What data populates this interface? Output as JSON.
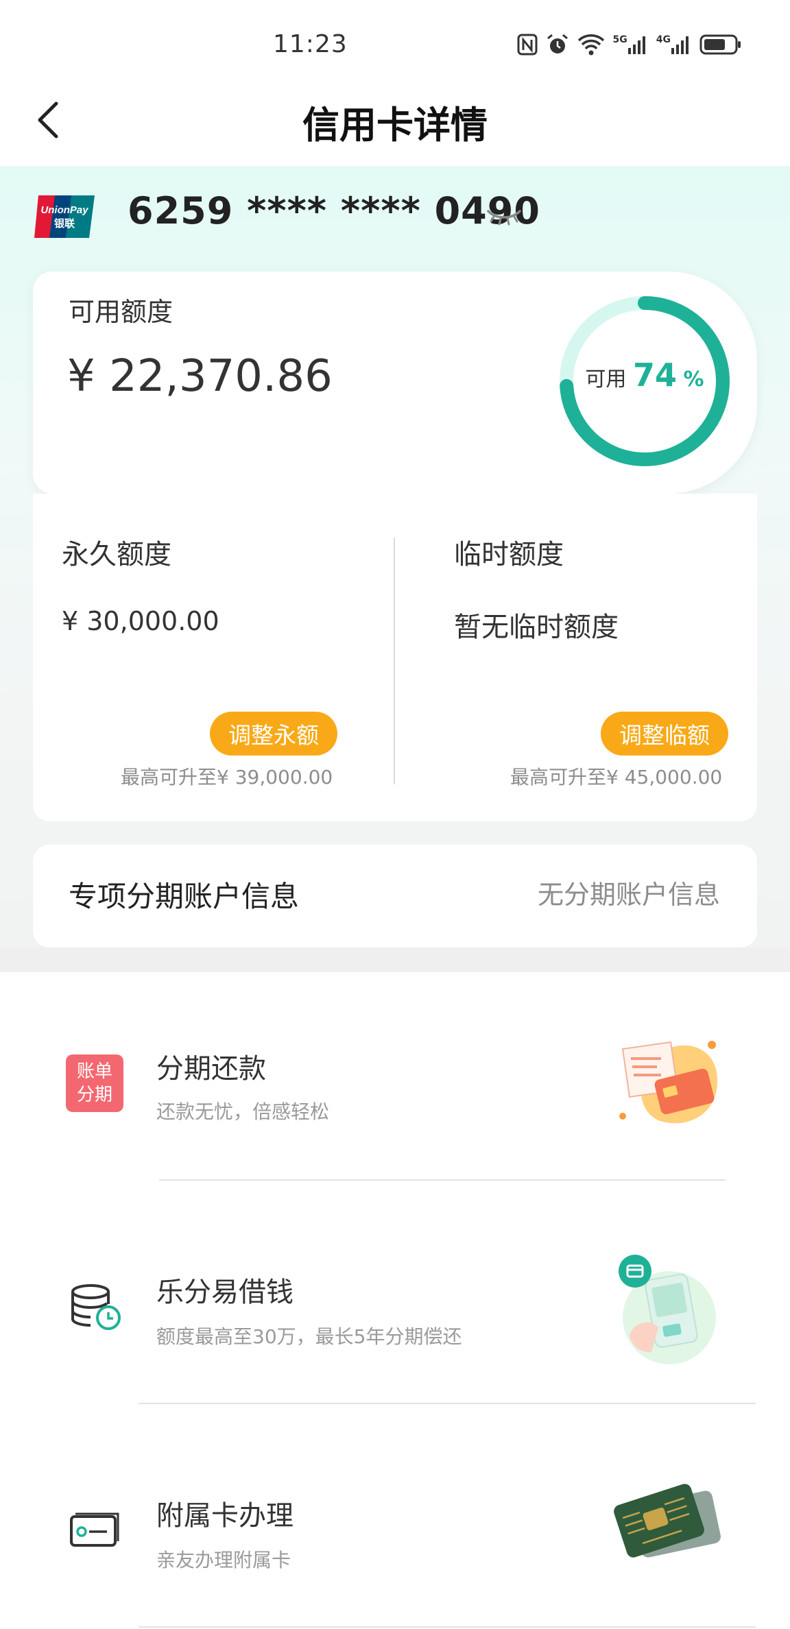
{
  "status_bar": {
    "time": "11:23",
    "icons": [
      "nfc-icon",
      "alarm-icon",
      "wifi-icon",
      "5g-signal-icon",
      "4g-signal-icon",
      "battery-icon"
    ],
    "network_5g": "5G",
    "network_4g": "4G"
  },
  "nav": {
    "back_icon": "chevron-left-icon",
    "title": "信用卡详情"
  },
  "card": {
    "brand_logo": "unionpay-logo",
    "brand_text_en": "UnionPay",
    "brand_text_cn": "银联",
    "number_masked": "6259 **** **** 0490",
    "visibility_icon": "eye-closed-icon"
  },
  "available": {
    "label": "可用额度",
    "amount": "¥ 22,370.86",
    "ring_label": "可用",
    "ring_percent": "74",
    "ring_percent_sign": "%",
    "ring_fraction": 0.74
  },
  "permanent": {
    "label": "永久额度",
    "amount": "¥ 30,000.00",
    "button": "调整永额",
    "max_note": "最高可升至¥ 39,000.00"
  },
  "temporary": {
    "label": "临时额度",
    "amount": "暂无临时额度",
    "button": "调整临额",
    "max_note": "最高可升至¥ 45,000.00"
  },
  "installment_account": {
    "label": "专项分期账户信息",
    "value": "无分期账户信息"
  },
  "services": [
    {
      "icon": "bill-installment-icon",
      "icon_text_line1": "账单",
      "icon_text_line2": "分期",
      "title": "分期还款",
      "subtitle": "还款无忧，倍感轻松",
      "illustration": "bill-card-illustration"
    },
    {
      "icon": "coin-clock-icon",
      "title": "乐分易借钱",
      "subtitle": "额度最高至30万，最长5年分期偿还",
      "illustration": "phone-hand-illustration"
    },
    {
      "icon": "card-outline-icon",
      "title": "附属卡办理",
      "subtitle": "亲友办理附属卡",
      "illustration": "green-cards-illustration"
    }
  ],
  "colors": {
    "accent_green": "#1fb197",
    "ring_track": "#d5f7ef",
    "button_orange": "#f9a917",
    "bill_icon_red": "#f36870"
  }
}
